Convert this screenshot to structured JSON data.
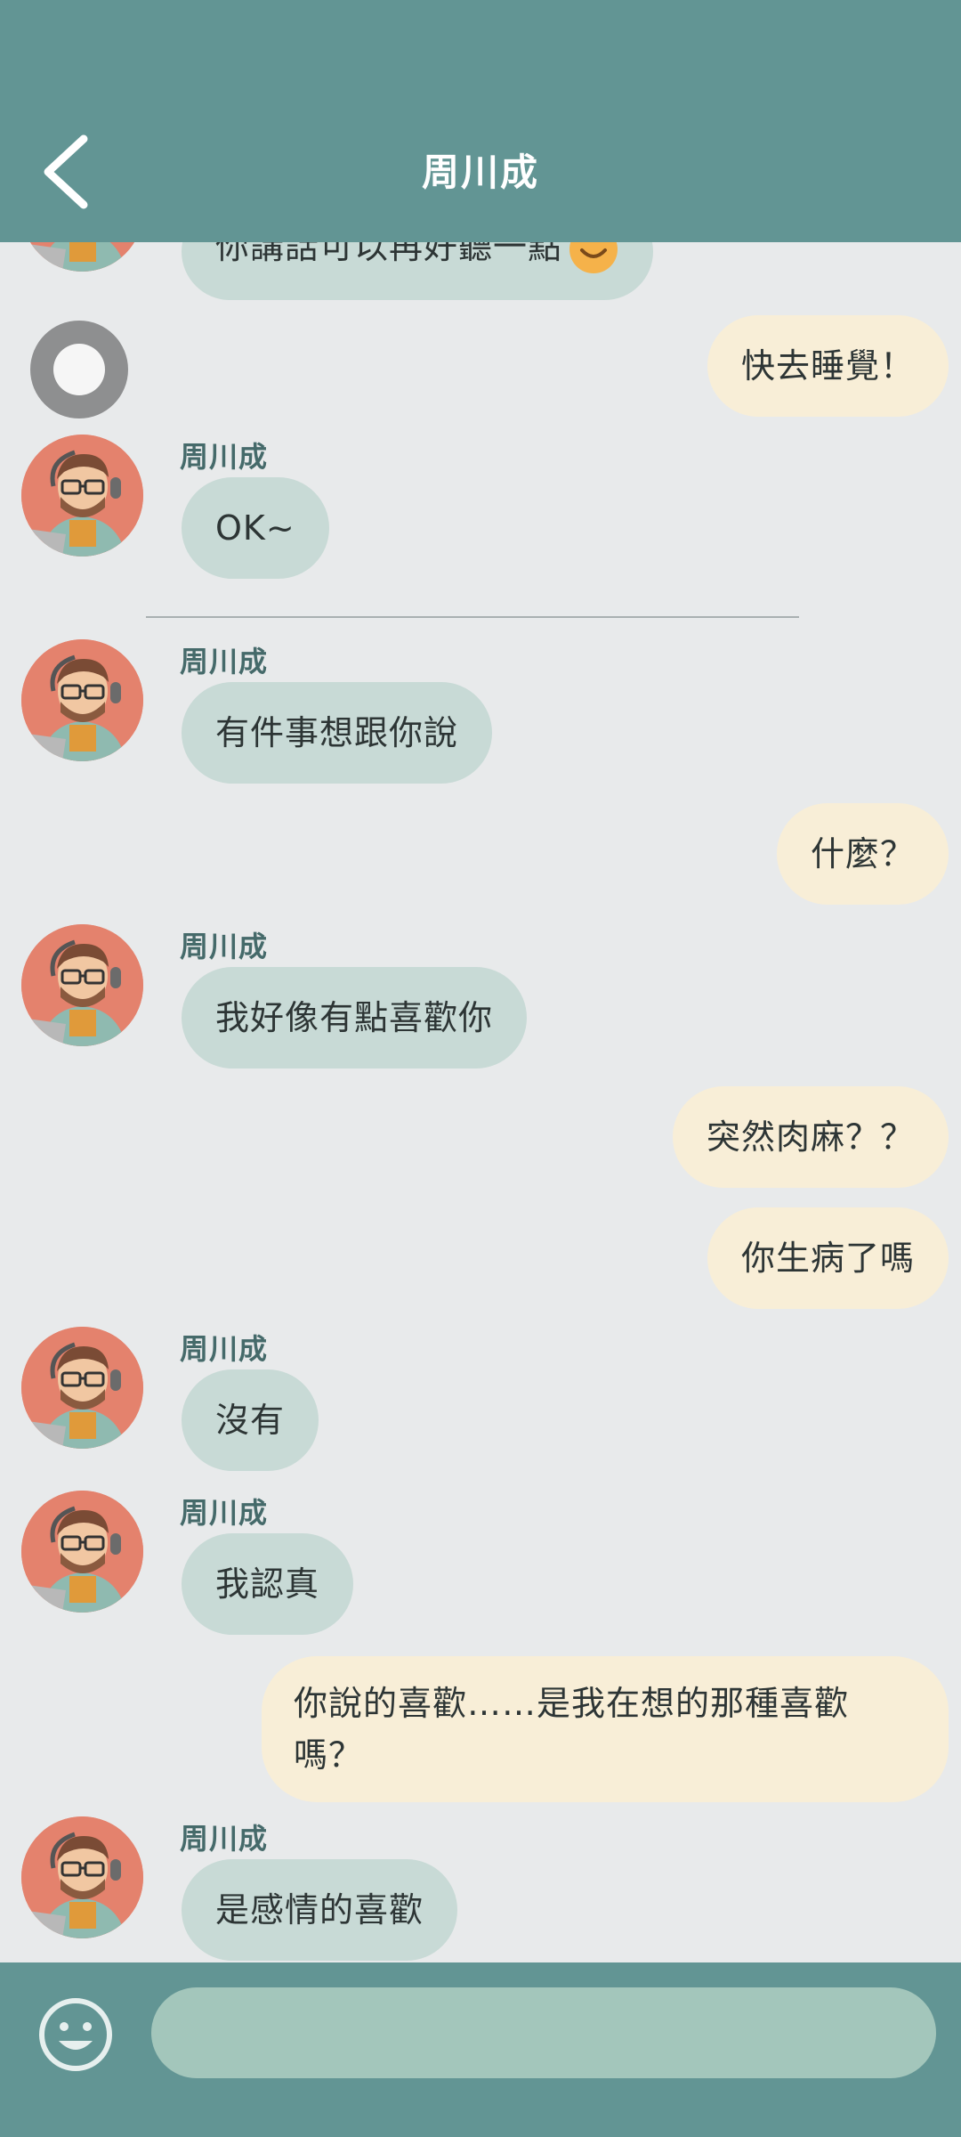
{
  "header": {
    "title": "周川成",
    "back_icon": "chevron-left-icon"
  },
  "colors": {
    "header_bg": "#629594",
    "chat_bg": "#e8eaeb",
    "incoming_bubble": "#c8dad6",
    "outgoing_bubble": "#f8eed7",
    "input_bg": "#a3c6bb"
  },
  "messages": {
    "m0": {
      "text": "你講話可以再好聽一點",
      "emoji": "smiling-face-icon"
    },
    "m1": {
      "text": "快去睡覺！"
    },
    "m2": {
      "sender": "周川成",
      "text": "OK~"
    },
    "m3": {
      "sender": "周川成",
      "text": "有件事想跟你說"
    },
    "m4": {
      "text": "什麼？"
    },
    "m5": {
      "sender": "周川成",
      "text": "我好像有點喜歡你"
    },
    "m6": {
      "text": "突然肉麻？？"
    },
    "m7": {
      "text": "你生病了嗎"
    },
    "m8": {
      "sender": "周川成",
      "text": "沒有"
    },
    "m9": {
      "sender": "周川成",
      "text": "我認真"
    },
    "m10": {
      "text": "你說的喜歡……是我在想的那種喜歡嗎？"
    },
    "m11": {
      "sender": "周川成",
      "text": "是感情的喜歡"
    }
  },
  "input": {
    "value": "",
    "placeholder": "",
    "emoji_icon": "smiley-icon"
  }
}
